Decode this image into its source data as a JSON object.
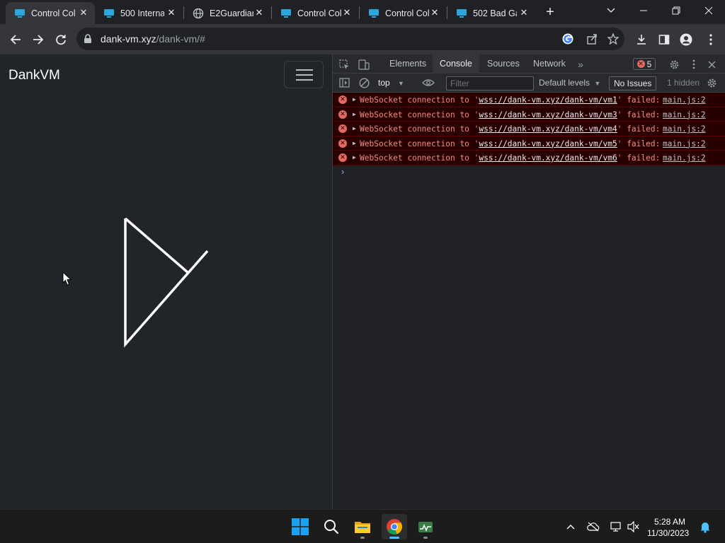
{
  "browser": {
    "tabs": [
      {
        "label": "Control Col",
        "icon": "monitor-icon",
        "active": true
      },
      {
        "label": "500 Interna",
        "icon": "monitor-icon",
        "active": false
      },
      {
        "label": "E2Guardian",
        "icon": "globe-icon",
        "active": false
      },
      {
        "label": "Control Col",
        "icon": "monitor-icon",
        "active": false
      },
      {
        "label": "Control Col",
        "icon": "monitor-icon",
        "active": false
      },
      {
        "label": "502 Bad Ga",
        "icon": "monitor-icon",
        "active": false
      }
    ],
    "address": {
      "host": "dank-vm.xyz",
      "path": "/dank-vm/#"
    }
  },
  "page": {
    "brand": "DankVM"
  },
  "devtools": {
    "tabs": [
      "Elements",
      "Console",
      "Sources",
      "Network"
    ],
    "active_tab": "Console",
    "error_count": "5",
    "context": "top",
    "filter_placeholder": "Filter",
    "levels": "Default levels",
    "issues": "No Issues",
    "hidden": "1 hidden",
    "messages": [
      {
        "prefix": "WebSocket connection to '",
        "url": "wss://dank-vm.xyz/dank-vm/vm1",
        "suffix": "' failed:",
        "source": "main.js:2"
      },
      {
        "prefix": "WebSocket connection to '",
        "url": "wss://dank-vm.xyz/dank-vm/vm3",
        "suffix": "' failed:",
        "source": "main.js:2"
      },
      {
        "prefix": "WebSocket connection to '",
        "url": "wss://dank-vm.xyz/dank-vm/vm4",
        "suffix": "' failed:",
        "source": "main.js:2"
      },
      {
        "prefix": "WebSocket connection to '",
        "url": "wss://dank-vm.xyz/dank-vm/vm5",
        "suffix": "' failed:",
        "source": "main.js:2"
      },
      {
        "prefix": "WebSocket connection to '",
        "url": "wss://dank-vm.xyz/dank-vm/vm6",
        "suffix": "' failed:",
        "source": "main.js:2"
      }
    ],
    "prompt": "›"
  },
  "taskbar": {
    "time": "5:28 AM",
    "date": "11/30/2023"
  },
  "colors": {
    "page_bg": "#212529",
    "devtools_bg": "#202124",
    "error_row_bg": "#290000",
    "error_text": "#f28b82",
    "accent": "#4cc2ff"
  }
}
